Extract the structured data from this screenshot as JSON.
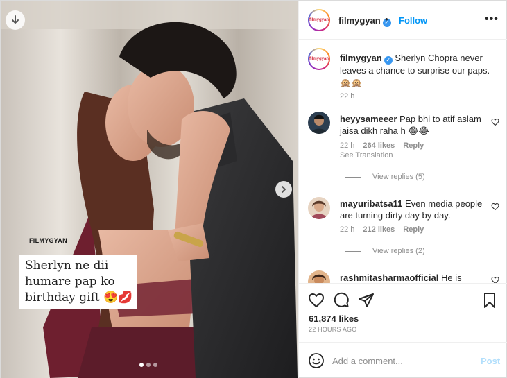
{
  "colors": {
    "accent": "#0095f6",
    "verified": "#3897f0",
    "muted": "#8e8e8e",
    "post_disabled": "#b2dffc"
  },
  "media": {
    "watermark": "FILMYGYAN",
    "caption_lines": [
      "Sherlyn ne dii",
      "humare pap ko",
      "birthday gift 😍💋"
    ],
    "carousel_dots": 3,
    "active_dot": 1,
    "icons": {
      "download": "download-arrow-icon",
      "next": "chevron-right-icon"
    }
  },
  "header": {
    "username": "filmygyan",
    "verified_icon": "verified-badge-icon",
    "separator": "•",
    "follow_label": "Follow",
    "more_label": "•••",
    "avatar_text": "filmygyan"
  },
  "caption": {
    "username": "filmygyan",
    "text": "Sherlyn Chopra never leaves a chance to surprise our paps. 🙊🙊",
    "time": "22 h"
  },
  "comments": [
    {
      "username": "heyysameeer",
      "text": "Pap bhi to atif aslam jaisa dikh raha h 😂😂",
      "time": "22 h",
      "likes": "264 likes",
      "reply_label": "Reply",
      "translation_label": "See Translation",
      "view_replies": "View replies (5)"
    },
    {
      "username": "mayuribatsa11",
      "text": "Even media people are turning dirty day by day.",
      "time": "22 h",
      "likes": "212 likes",
      "reply_label": "Reply",
      "view_replies": "View replies (2)"
    },
    {
      "username": "rashmitasharmaofficial",
      "text": "He is"
    }
  ],
  "actions": {
    "icons": [
      "heart-icon",
      "comment-icon",
      "share-icon",
      "bookmark-icon"
    ],
    "likes": "61,874 likes",
    "time_ago": "22 HOURS AGO"
  },
  "add_comment": {
    "placeholder": "Add a comment...",
    "post_label": "Post",
    "emoji_icon": "emoji-smile-icon"
  }
}
